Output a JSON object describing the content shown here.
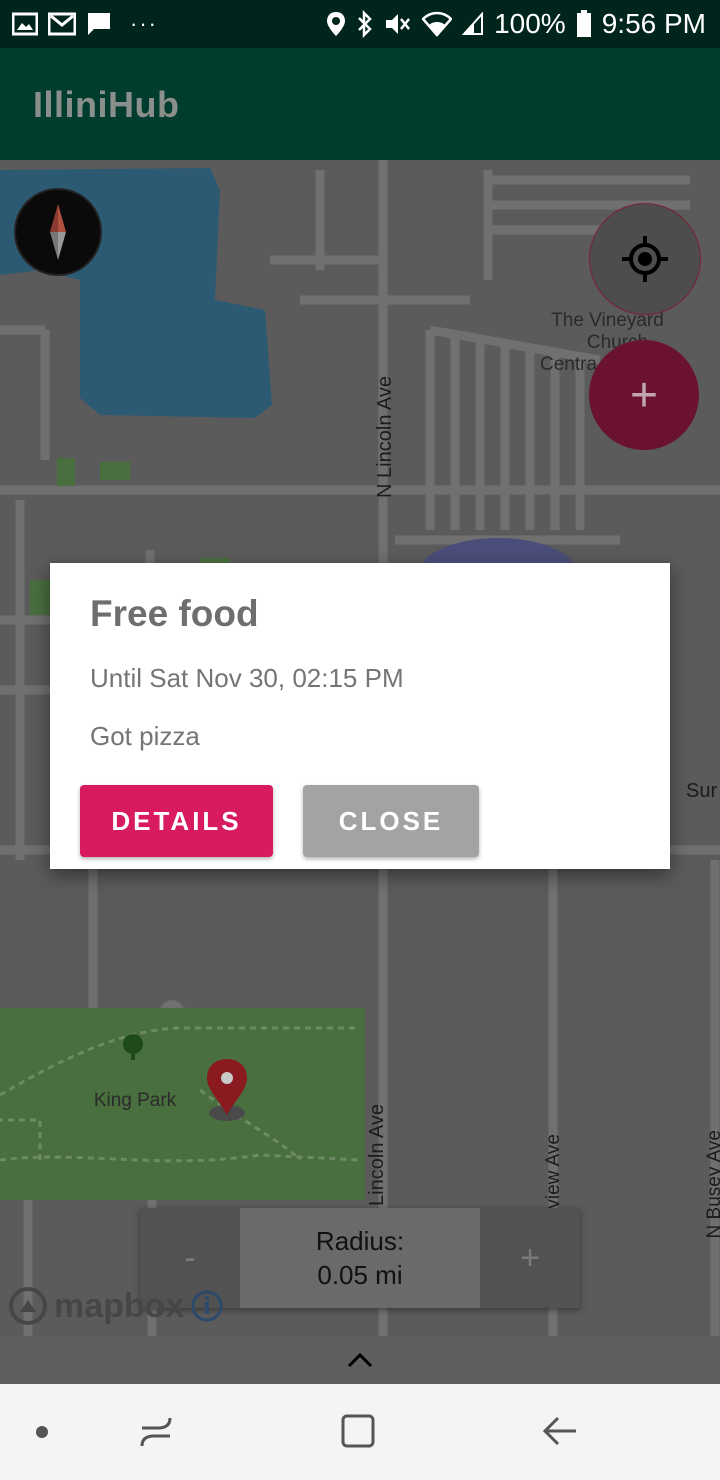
{
  "status_bar": {
    "battery_text": "100%",
    "time": "9:56 PM",
    "more_dots": "···"
  },
  "app_bar": {
    "title": "IlliniHub"
  },
  "map": {
    "streets": {
      "lincoln_top": "N Lincoln Ave",
      "lincoln_bottom": "N Lincoln Ave",
      "linview": "N Linview Ave",
      "busey": "N Busey Ave",
      "sunset_partial": "Sur"
    },
    "poi": {
      "vineyard_line1": "The Vineyard",
      "vineyard_line2": "Church",
      "vineyard_line3": "Centra",
      "king_park": "King Park"
    },
    "attribution": "mapbox"
  },
  "radius": {
    "minus_label": "-",
    "plus_label": "+",
    "label": "Radius:",
    "value": "0.05 mi"
  },
  "fab": {
    "add_label": "+"
  },
  "dialog": {
    "title": "Free food",
    "until": "Until Sat Nov 30, 02:15 PM",
    "description": "Got pizza",
    "details_label": "DETAILS",
    "close_label": "CLOSE"
  },
  "colors": {
    "accent": "#d81b60",
    "app_bar": "#003d2e",
    "status_bar": "#00251c"
  }
}
